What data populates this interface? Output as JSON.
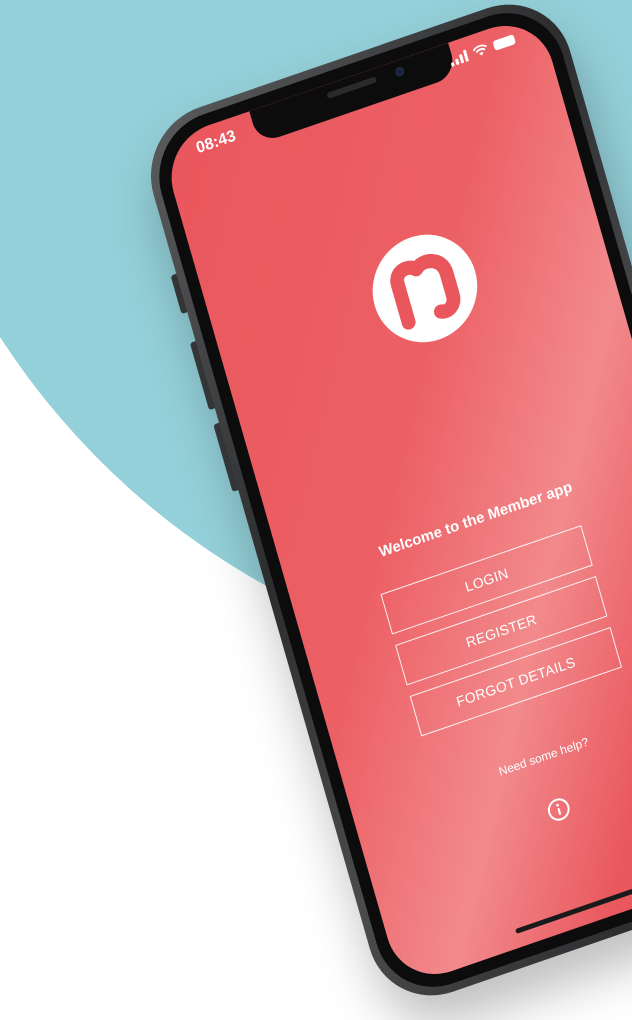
{
  "status_bar": {
    "time": "08:43"
  },
  "app": {
    "logo_icon": "member-app-logo",
    "welcome_text": "Welcome to the Member app",
    "buttons": {
      "login": "LOGIN",
      "register": "REGISTER",
      "forgot": "FORGOT DETAILS"
    },
    "help_text": "Need some help?",
    "info_icon": "info-icon"
  },
  "colors": {
    "screen_bg": "#e9575d",
    "background_accent": "#94d0d9",
    "button_border": "#ffffff"
  }
}
